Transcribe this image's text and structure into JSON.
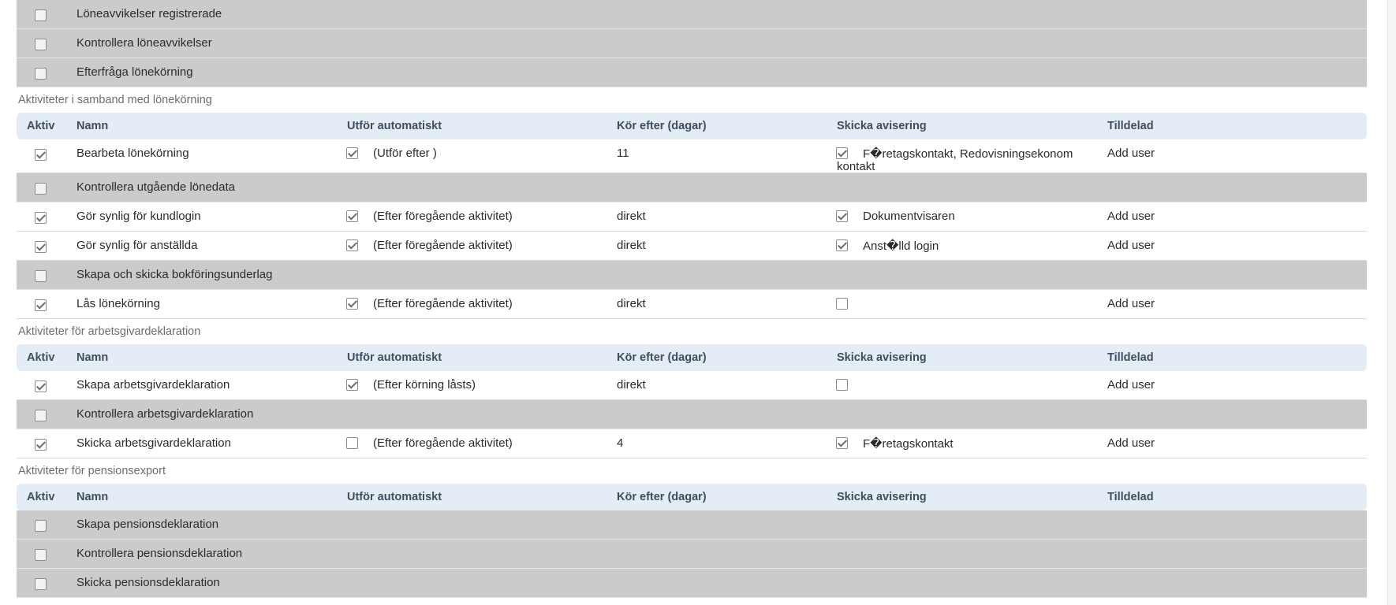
{
  "columns": {
    "aktiv": "Aktiv",
    "namn": "Namn",
    "utfor": "Utför automatiskt",
    "kor": "Kör efter (dagar)",
    "skicka": "Skicka avisering",
    "tilldelad": "Tilldelad"
  },
  "top_rows": [
    {
      "name": "Löneavvikelser registrerade",
      "aktiv": false
    },
    {
      "name": "Kontrollera löneavvikelser",
      "aktiv": false
    },
    {
      "name": "Efterfråga lönekörning",
      "aktiv": false
    }
  ],
  "sections": [
    {
      "title": "Aktiviteter i samband med lönekörning",
      "rows": [
        {
          "name": "Bearbeta lönekörning",
          "aktiv": true,
          "auto": true,
          "auto_text": "(Utför efter )",
          "days": "11",
          "notify": true,
          "notify_text": "F�retagskontakt, Redovisningsekonom",
          "notify_text_2": "kontakt",
          "assigned": "Add user"
        },
        {
          "name": "Kontrollera utgående lönedata",
          "aktiv": false
        },
        {
          "name": "Gör synlig för kundlogin",
          "aktiv": true,
          "auto": true,
          "auto_text": "(Efter föregående aktivitet)",
          "days": "direkt",
          "notify": true,
          "notify_text": "Dokumentvisaren",
          "assigned": "Add user"
        },
        {
          "name": "Gör synlig för anställda",
          "aktiv": true,
          "auto": true,
          "auto_text": "(Efter föregående aktivitet)",
          "days": "direkt",
          "notify": true,
          "notify_text": "Anst�lld login",
          "assigned": "Add user"
        },
        {
          "name": "Skapa och skicka bokföringsunderlag",
          "aktiv": false
        },
        {
          "name": "Lås lönekörning",
          "aktiv": true,
          "auto": true,
          "auto_text": "(Efter föregående aktivitet)",
          "days": "direkt",
          "notify": false,
          "notify_text": "",
          "assigned": "Add user"
        }
      ]
    },
    {
      "title": "Aktiviteter för arbetsgivardeklaration",
      "rows": [
        {
          "name": "Skapa arbetsgivardeklaration",
          "aktiv": true,
          "auto": true,
          "auto_text": "(Efter körning låsts)",
          "days": "direkt",
          "notify": false,
          "notify_text": "",
          "assigned": "Add user"
        },
        {
          "name": "Kontrollera arbetsgivardeklaration",
          "aktiv": false
        },
        {
          "name": "Skicka arbetsgivardeklaration",
          "aktiv": true,
          "auto": false,
          "auto_text": "(Efter föregående aktivitet)",
          "days": "4",
          "notify": true,
          "notify_text": "F�retagskontakt",
          "assigned": "Add user"
        }
      ]
    },
    {
      "title": "Aktiviteter för pensionsexport",
      "rows": [
        {
          "name": "Skapa pensionsdeklaration",
          "aktiv": false
        },
        {
          "name": "Kontrollera pensionsdeklaration",
          "aktiv": false
        },
        {
          "name": "Skicka pensionsdeklaration",
          "aktiv": false
        }
      ]
    }
  ]
}
